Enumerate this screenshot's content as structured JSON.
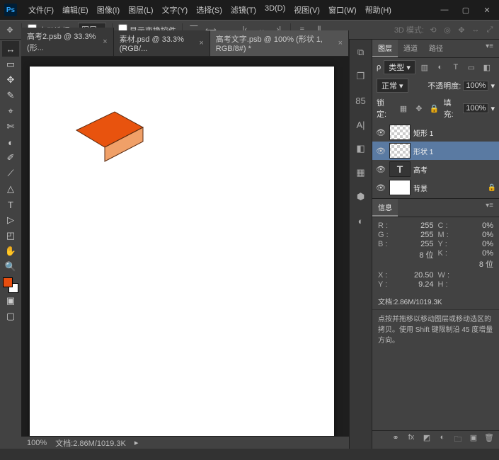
{
  "menu": [
    "文件(F)",
    "编辑(E)",
    "图像(I)",
    "图层(L)",
    "文字(Y)",
    "选择(S)",
    "滤镜(T)",
    "3D(D)",
    "视图(V)",
    "窗口(W)",
    "帮助(H)"
  ],
  "optbar": {
    "auto_select": "自动选择:",
    "auto_select_target": "图层",
    "show_transform": "显示变换控件",
    "threed_mode": "3D 模式:"
  },
  "tabs": [
    {
      "label": "高考2.psb @ 33.3% (形...",
      "active": false
    },
    {
      "label": "素材.psd @ 33.3%(RGB/...",
      "active": false
    },
    {
      "label": "高考文字.psb @ 100% (形状 1, RGB/8#) *",
      "active": true
    }
  ],
  "status": {
    "zoom": "100%",
    "doc": "文档:2.86M/1019.3K"
  },
  "layers_panel": {
    "tabs": [
      "图层",
      "通道",
      "路径"
    ],
    "type": "类型",
    "blend": "正常",
    "opacity_label": "不透明度:",
    "opacity": "100%",
    "lock_label": "锁定:",
    "fill_label": "填充:",
    "fill": "100%",
    "layers": [
      {
        "name": "矩形 1",
        "selected": false,
        "kind": "shape"
      },
      {
        "name": "形状 1",
        "selected": true,
        "kind": "shape"
      },
      {
        "name": "高考",
        "selected": false,
        "kind": "text"
      },
      {
        "name": "背景",
        "selected": false,
        "kind": "bg",
        "locked": true
      }
    ]
  },
  "info": {
    "tab": "信息",
    "rgb": {
      "R": "255",
      "G": "255",
      "B": "255"
    },
    "cmyk": {
      "C": "0%",
      "M": "0%",
      "Y": "0%",
      "K": "0%"
    },
    "bit": "8 位",
    "bit2": "8 位",
    "xy": {
      "X": "20.50",
      "Y": "9.24"
    },
    "wh": {
      "W": "",
      "H": ""
    },
    "doc": "文档:2.86M/1019.3K",
    "hint": "点按并拖移以移动图层或移动选区的拷贝。使用 Shift 键限制沿 45 度增量方向。"
  },
  "tools": [
    "↔",
    "▭",
    "✥",
    "✎",
    "⌖",
    "✄",
    "◐",
    "✐",
    "⟋",
    "△",
    "T",
    "▷",
    "◰",
    "✋",
    "🔍"
  ],
  "rail": [
    "⧉",
    "❐",
    "85",
    "A|",
    "◧",
    "▦",
    "⬢",
    "◐"
  ]
}
